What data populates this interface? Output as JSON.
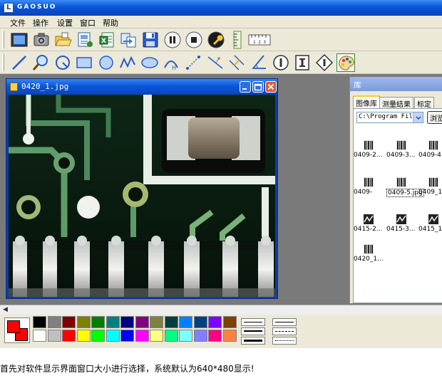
{
  "app": {
    "title": "GAOSUO"
  },
  "menubar": {
    "items": [
      "文件",
      "操作",
      "设置",
      "窗口",
      "帮助"
    ]
  },
  "toolbar1": {
    "tools": [
      "capture-icon",
      "camera-icon",
      "open-folder-icon",
      "image-list-icon",
      "excel-icon",
      "transfer-icon",
      "save-icon",
      "pause-icon",
      "stop-icon",
      "settings-wrench-icon",
      "ruler-vertical-icon",
      "ruler-horizontal-icon"
    ],
    "ruler_ticks": "1 2 3"
  },
  "toolbar2": {
    "tools": [
      "line-tool-icon",
      "magnifier-icon",
      "arc-circle-icon",
      "rectangle-tool-icon",
      "circle-tool-icon",
      "polyline-tool-icon",
      "ellipse-tool-icon",
      "arc-height-icon",
      "distance-tool-icon",
      "point-line-distance-icon",
      "parallel-distance-icon",
      "angle-tool-icon",
      "info-circle-icon",
      "text-tool-icon",
      "diamond-info-icon",
      "palette-icon"
    ],
    "arc_label": "H"
  },
  "image_window": {
    "title": "0420_1.jpg"
  },
  "library": {
    "title": "库",
    "tabs": [
      "图像库",
      "测量结果",
      "标定"
    ],
    "path": "C:\\Program Files",
    "browse_label": "浏览",
    "thumbnails": [
      {
        "label": "0409-2...",
        "kind": "barcode"
      },
      {
        "label": "0409-3...",
        "kind": "barcode"
      },
      {
        "label": "0409-4",
        "kind": "barcode"
      },
      {
        "label": "0409-",
        "kind": "barcode"
      },
      {
        "label": "0409-5.jpg",
        "kind": "barcode",
        "selected": true
      },
      {
        "label": "0409_1",
        "kind": "barcode"
      },
      {
        "label": "0415-2...",
        "kind": "wave"
      },
      {
        "label": "0415-3...",
        "kind": "wave"
      },
      {
        "label": "0415_1",
        "kind": "wave"
      },
      {
        "label": "0420_1...",
        "kind": "barcode"
      }
    ]
  },
  "palette": {
    "foreground": "#ff0000",
    "background": "#ff0000",
    "row1": [
      "#000000",
      "#808080",
      "#800000",
      "#808000",
      "#008000",
      "#008080",
      "#000080",
      "#800080",
      "#808040",
      "#004040",
      "#0080ff",
      "#004080",
      "#8000ff",
      "#804000"
    ],
    "row2": [
      "#ffffff",
      "#c0c0c0",
      "#ff0000",
      "#ffff00",
      "#00ff00",
      "#00ffff",
      "#0000ff",
      "#ff00ff",
      "#ffff80",
      "#00ff80",
      "#80ffff",
      "#8080ff",
      "#ff0080",
      "#ff8040"
    ]
  },
  "caption": "首先对软件显示界面窗口大小进行选择，系统默认为640*480显示!"
}
